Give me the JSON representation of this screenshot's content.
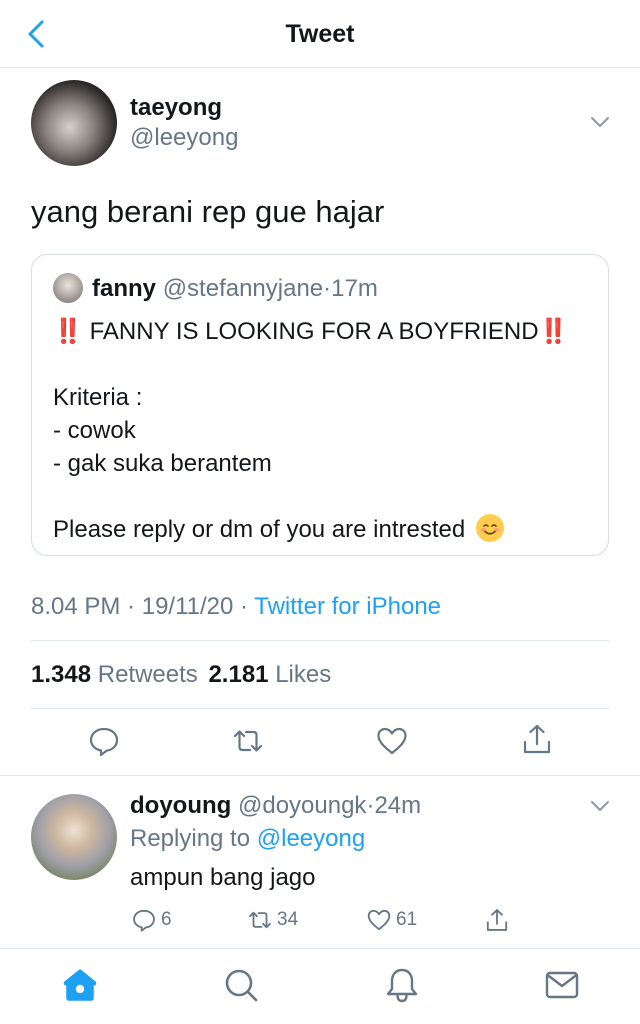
{
  "header": {
    "title": "Tweet"
  },
  "tweet": {
    "name": "taeyong",
    "handle": "@leeyong",
    "text": "yang berani rep gue hajar",
    "quote": {
      "name": "fanny",
      "handle": "@stefannyjane",
      "separator": "·",
      "time": "17m",
      "bang_left": "‼️",
      "headline": "FANNY IS LOOKING FOR A BOYFRIEND",
      "bang_right": "‼️",
      "lines": [
        "Kriteria :",
        "- cowok",
        "- gak suka berantem"
      ],
      "closing": "Please reply or dm of you are intrested",
      "emoji": "smiling-face"
    },
    "meta": {
      "time": "8.04 PM",
      "sep1": " · ",
      "date": "19/11/20",
      "sep2": " · ",
      "source": "Twitter for iPhone"
    },
    "stats": {
      "retweets_count": "1.348",
      "retweets_label": "Retweets",
      "likes_count": "2.181",
      "likes_label": "Likes"
    }
  },
  "reply": {
    "name": "doyoung",
    "handle": "@doyoungk",
    "separator": "·",
    "time": "24m",
    "replying_prefix": "Replying to",
    "replying_to": "@leeyong",
    "text": "ampun bang jago",
    "reply_count": "6",
    "retweet_count": "34",
    "like_count": "61"
  },
  "nav": {
    "items": [
      "home-icon",
      "search-icon",
      "notifications-icon",
      "messages-icon"
    ],
    "active": "home-icon"
  },
  "colors": {
    "accent": "#1da1f2",
    "text": "#14171a",
    "secondary": "#657786",
    "border": "#e1e8ed",
    "alert": "#e0245e"
  }
}
